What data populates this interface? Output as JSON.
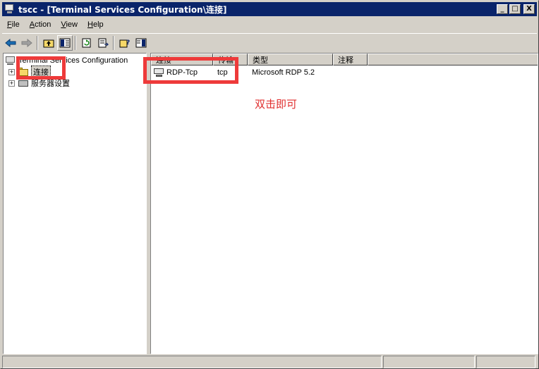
{
  "window": {
    "title": "tscc - [Terminal Services Configuration\\连接]"
  },
  "title_buttons": {
    "minimize": "_",
    "maximize": "□",
    "close": "X"
  },
  "menu": [
    {
      "underline": "F",
      "rest": "ile"
    },
    {
      "underline": "A",
      "rest": "ction"
    },
    {
      "underline": "V",
      "rest": "iew"
    },
    {
      "underline": "H",
      "rest": "elp"
    }
  ],
  "toolbar": {
    "icons": [
      "back-arrow-icon",
      "forward-arrow-icon",
      "up-folder-icon",
      "show-hide-tree-icon",
      "refresh-icon",
      "export-list-icon",
      "help-icon",
      "properties-pane-icon"
    ]
  },
  "tree": {
    "root": "Terminal Services Configuration",
    "items": [
      "连接",
      "服务器设置"
    ]
  },
  "list": {
    "columns": [
      "连接",
      "传输",
      "类型",
      "注释"
    ],
    "rows": [
      {
        "name": "RDP-Tcp",
        "transport": "tcp",
        "type": "Microsoft RDP 5.2",
        "comment": ""
      }
    ]
  },
  "annotation": {
    "text": "双击即可",
    "color": "#ee3a3a"
  },
  "colors": {
    "titlebar": "#0a246a",
    "face": "#d4d0c8"
  }
}
